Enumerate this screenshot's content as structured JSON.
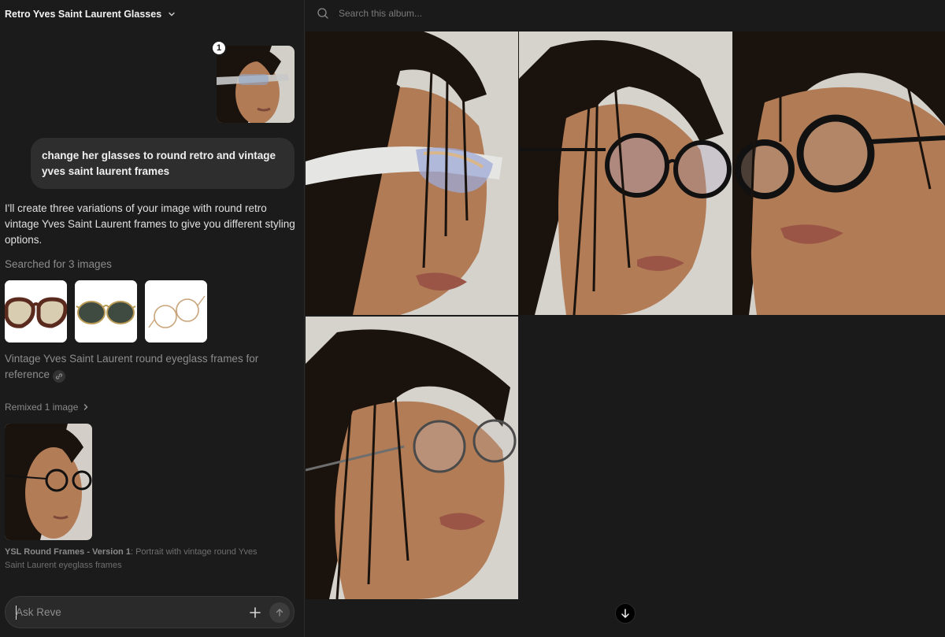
{
  "header": {
    "album_title": "Retro Yves Saint Laurent Glasses"
  },
  "chat": {
    "user_attachment_badge": "1",
    "user_message": "change her glasses to round retro and vintage yves saint laurent frames",
    "assistant_reply": "I'll create three variations of your image with round retro vintage Yves Saint Laurent frames to give you different styling options.",
    "search_status": "Searched for 3 images",
    "reference_caption": "Vintage Yves Saint Laurent round eyeglass frames for reference",
    "remix_label": "Remixed 1 image",
    "result_title": "YSL Round Frames - Version 1",
    "result_description": ": Portrait with vintage round Yves Saint Laurent eyeglass frames"
  },
  "composer": {
    "placeholder": "Ask Reve"
  },
  "gallery": {
    "search_placeholder": "Search this album..."
  },
  "colors": {
    "background": "#1a1a1a",
    "bubble": "#2e2e2e",
    "backdrop": "#d4d0ca",
    "skin": "#b07b55",
    "hair": "#1a120c"
  },
  "icons": [
    "chevron-down-icon",
    "search-icon",
    "link-icon",
    "chevron-right-icon",
    "plus-icon",
    "arrow-up-icon",
    "arrow-down-icon"
  ]
}
